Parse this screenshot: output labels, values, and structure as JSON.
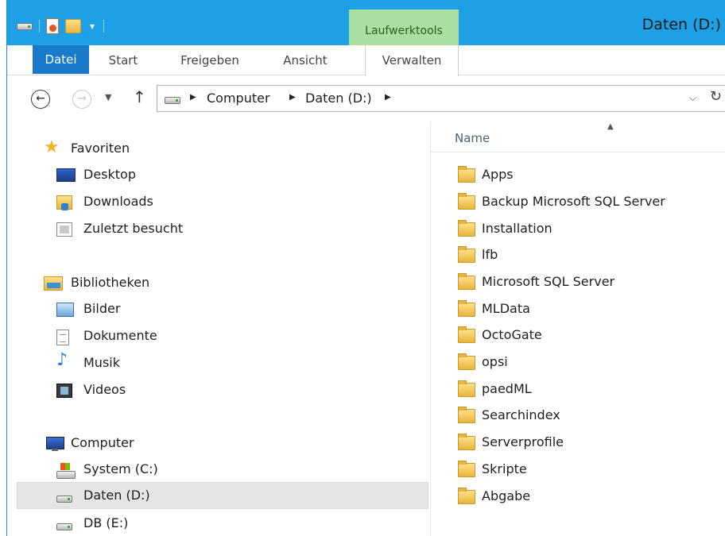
{
  "window": {
    "title": "Daten (D:)",
    "contextual_tab_group": "Laufwerktools"
  },
  "ribbon": {
    "tabs": [
      "Datei",
      "Start",
      "Freigeben",
      "Ansicht",
      "Verwalten"
    ]
  },
  "address_bar": {
    "breadcrumbs": [
      "Computer",
      "Daten (D:)"
    ]
  },
  "nav_pane": {
    "favorites": {
      "label": "Favoriten",
      "items": [
        "Desktop",
        "Downloads",
        "Zuletzt besucht"
      ]
    },
    "libraries": {
      "label": "Bibliotheken",
      "items": [
        "Bilder",
        "Dokumente",
        "Musik",
        "Videos"
      ]
    },
    "computer": {
      "label": "Computer",
      "items": [
        "System (C:)",
        "Daten (D:)",
        "DB (E:)"
      ],
      "selected": "Daten (D:)"
    }
  },
  "file_list": {
    "column_header": "Name",
    "items": [
      "Apps",
      "Backup Microsoft SQL Server",
      "Installation",
      "lfb",
      "Microsoft SQL Server",
      "MLData",
      "OctoGate",
      "opsi",
      "paedML",
      "Searchindex",
      "Serverprofile",
      "Skripte",
      "Abgabe"
    ]
  },
  "colors": {
    "titlebar": "#1ea0e6",
    "file_tab": "#1979ca",
    "contextual_tab": "#a9e0a0",
    "selection": "#e5e5e5"
  }
}
